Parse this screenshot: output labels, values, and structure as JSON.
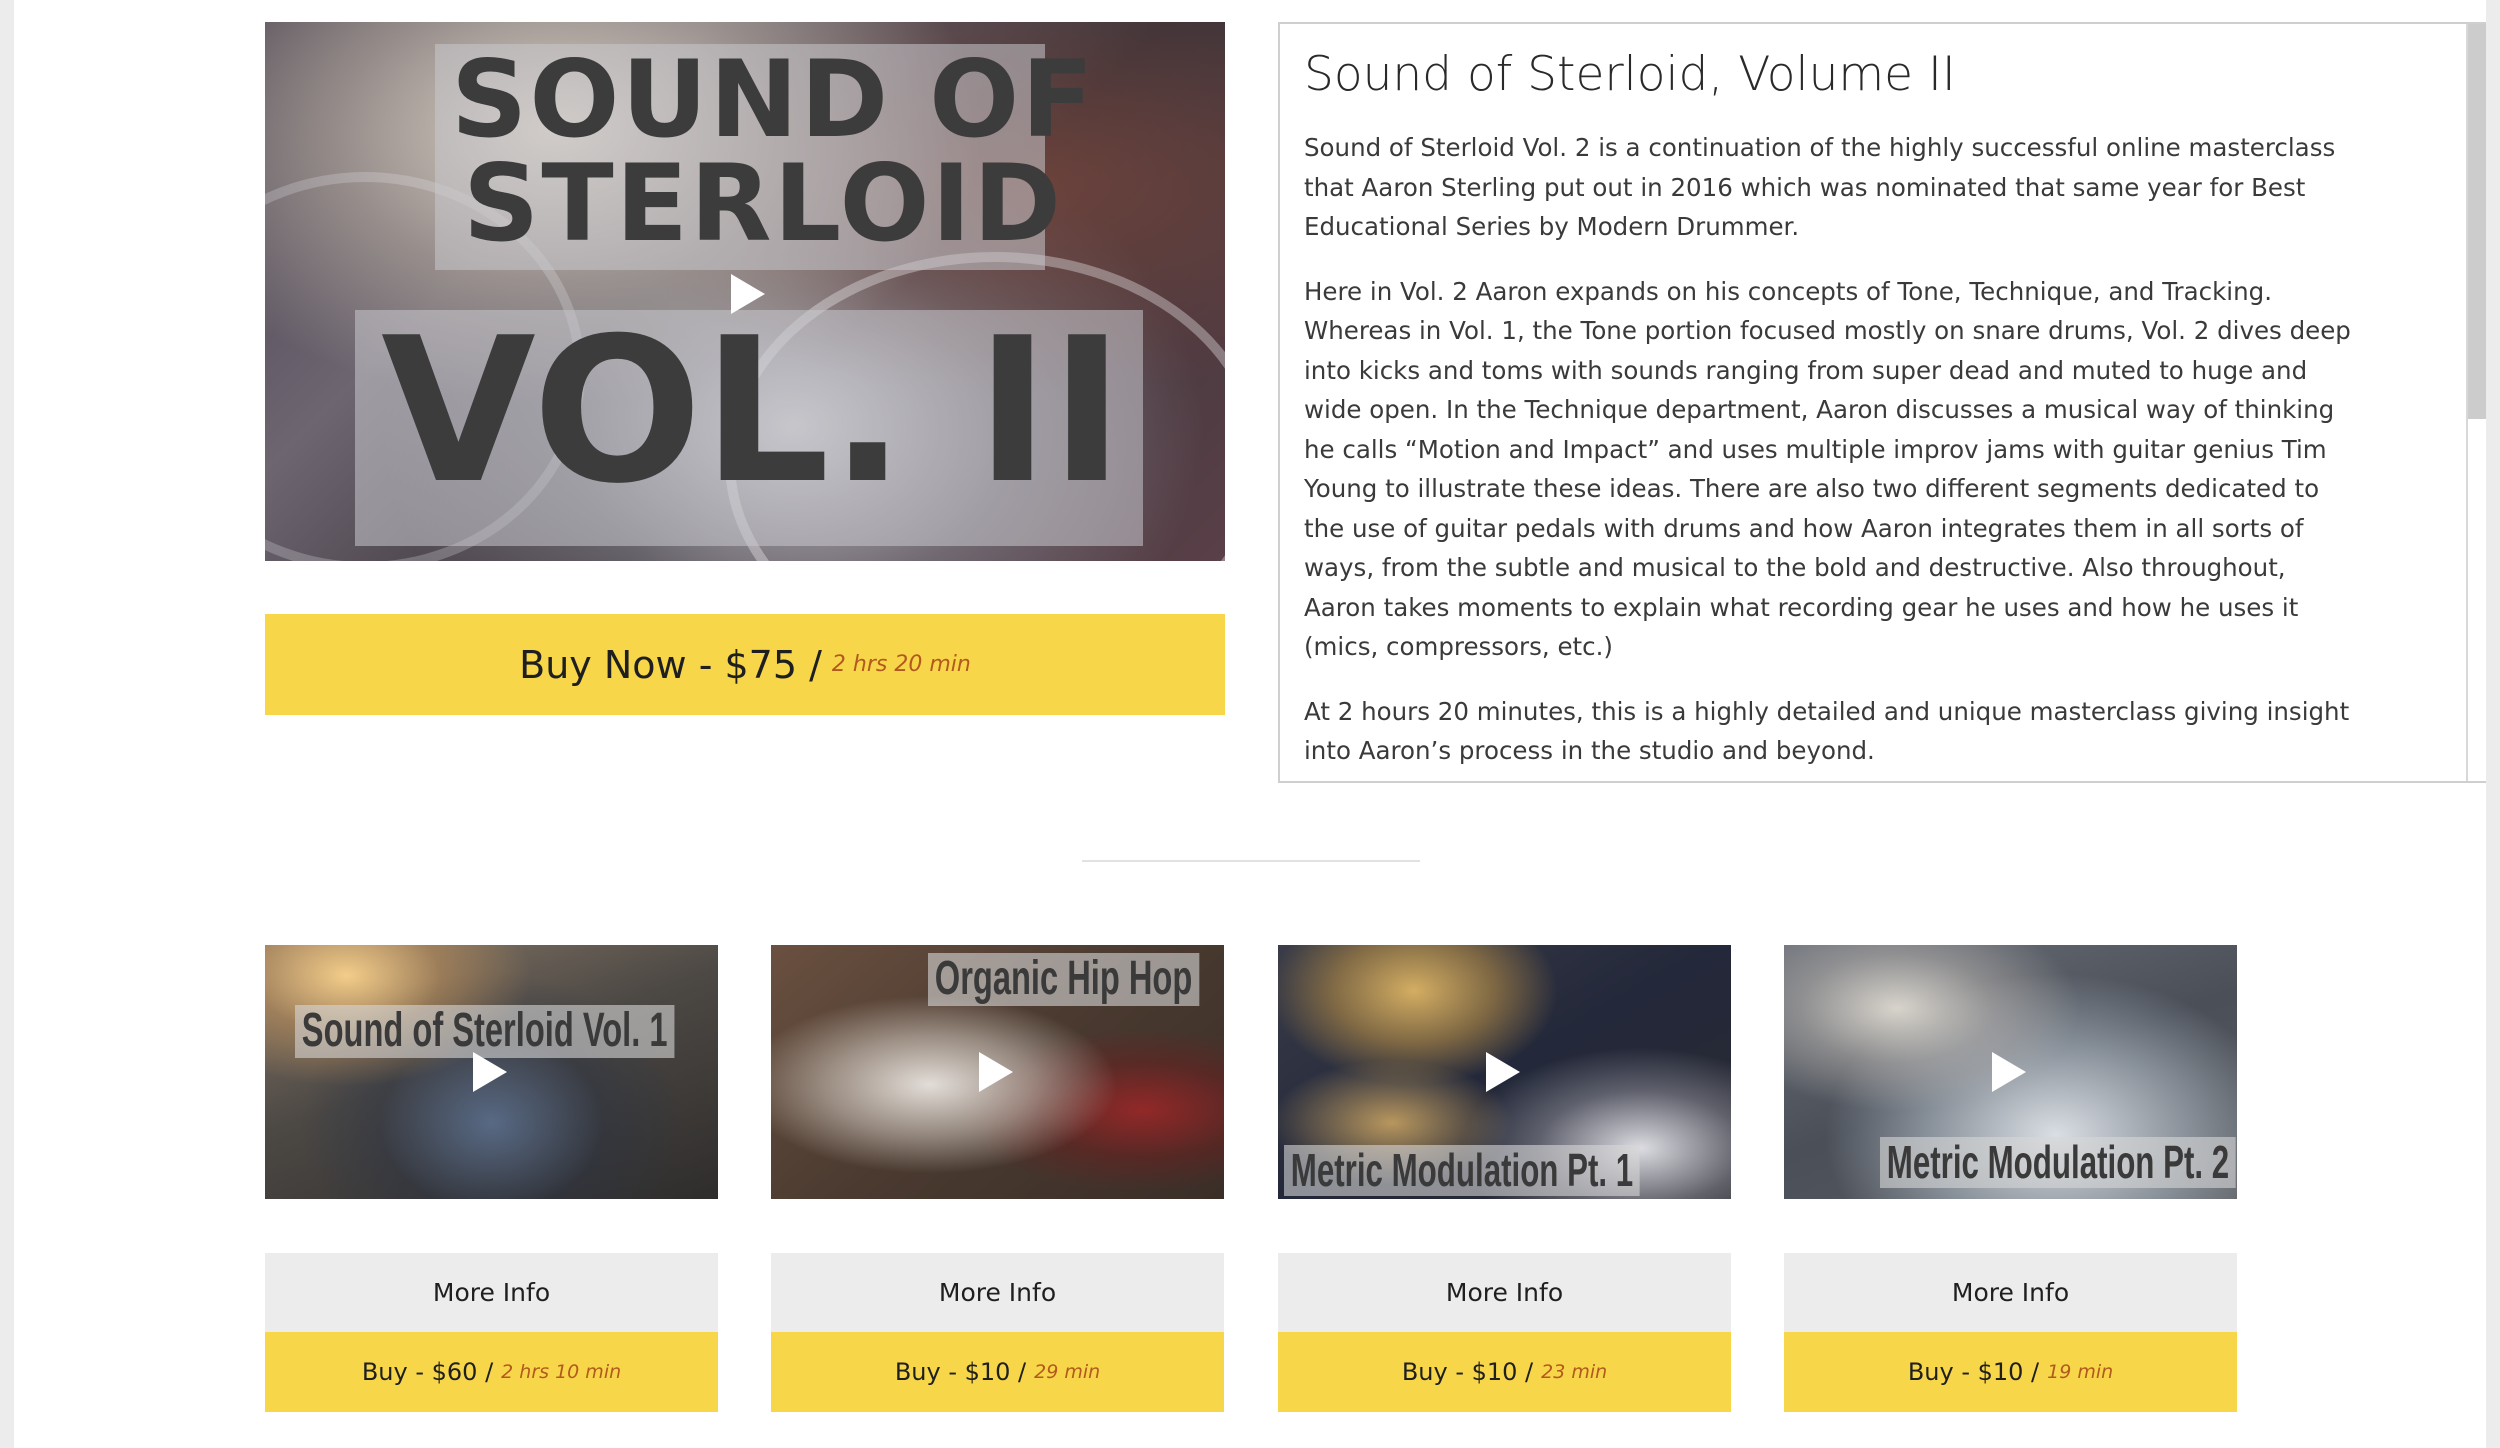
{
  "featured": {
    "image_title_line1": "SOUND OF",
    "image_title_line2": "STERLOID",
    "image_title_line3": "VOL. II",
    "buy_label": "Buy Now - $75 /",
    "buy_duration": "2 hrs 20 min"
  },
  "description": {
    "title": "Sound of Sterloid, Volume II",
    "paragraphs": [
      "Sound of Sterloid Vol. 2 is a continuation of the highly successful online masterclass that Aaron Sterling put out in 2016 which was nominated that same year for Best Educational Series by Modern Drummer.",
      "Here in Vol. 2 Aaron expands on his concepts of Tone, Technique, and Tracking. Whereas in Vol. 1, the Tone portion focused mostly on snare drums, Vol. 2 dives deep into kicks and toms with sounds ranging from super dead and muted to huge and wide open. In the Technique department, Aaron discusses a musical way of thinking he calls “Motion and Impact” and uses multiple improv jams with guitar genius Tim Young to illustrate these ideas. There are also two different segments dedicated to the use of guitar pedals with drums and how Aaron integrates them in all sorts of ways, from the subtle and musical to the bold and destructive. Also throughout, Aaron takes moments to explain what recording gear he uses and how he uses it (mics, compressors, etc.)",
      "At 2 hours 20 minutes, this is a highly detailed and unique masterclass giving insight into Aaron’s process in the studio and beyond."
    ]
  },
  "cards": [
    {
      "thumb_label": "Sound of Sterloid Vol. 1",
      "more_info_label": "More Info",
      "buy_label": "Buy - $60 /",
      "buy_duration": "2 hrs 10 min"
    },
    {
      "thumb_label": "Organic Hip Hop",
      "more_info_label": "More Info",
      "buy_label": "Buy - $10 /",
      "buy_duration": "29 min"
    },
    {
      "thumb_label": "Metric Modulation Pt. 1",
      "more_info_label": "More Info",
      "buy_label": "Buy - $10 /",
      "buy_duration": "23 min"
    },
    {
      "thumb_label": "Metric Modulation Pt. 2",
      "more_info_label": "More Info",
      "buy_label": "Buy - $10 /",
      "buy_duration": "19 min"
    }
  ],
  "colors": {
    "accent_yellow": "#f7d64a",
    "duration_orange": "#b25a1e",
    "more_info_gray": "#ececec"
  },
  "icons": {
    "play": "play-icon"
  }
}
